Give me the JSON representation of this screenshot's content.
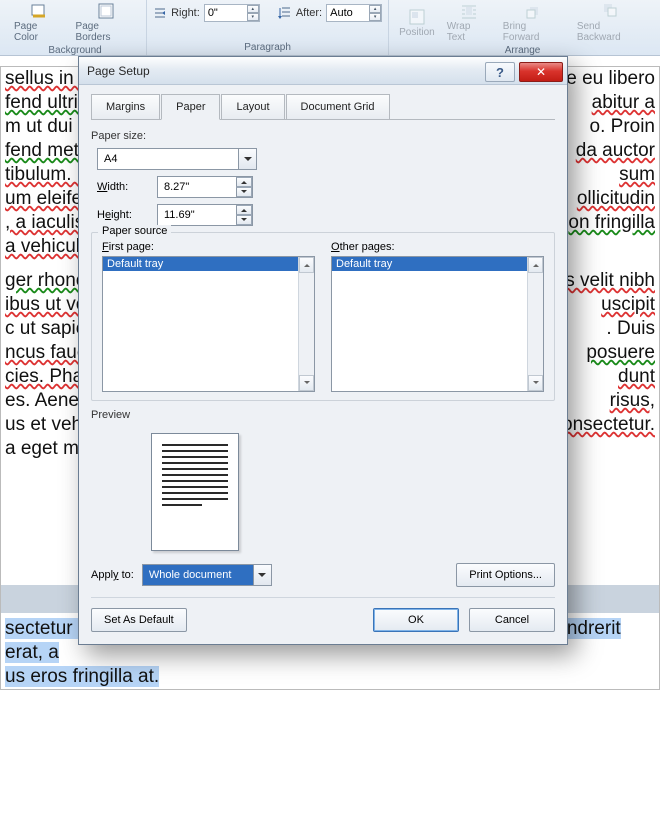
{
  "ribbon": {
    "page_group": {
      "color_label": "Page Color",
      "borders_label": "Page Borders",
      "group_label": "Background"
    },
    "para_group": {
      "right_label": "Right:",
      "right_val": "0\"",
      "after_label": "After:",
      "after_val": "Auto",
      "group_label": "Paragraph"
    },
    "arrange_group": {
      "position": "Position",
      "wrap": "Wrap Text",
      "bring": "Bring Forward",
      "send": "Send Backward",
      "group_label": "Arrange"
    }
  },
  "dialog": {
    "title": "Page Setup",
    "tabs": {
      "margins": "Margins",
      "paper": "Paper",
      "layout": "Layout",
      "grid": "Document Grid"
    },
    "paper_size_label": "Paper size:",
    "paper_size_value": "A4",
    "width_label": "Width:",
    "width_value": "8.27\"",
    "height_label": "Height:",
    "height_value": "11.69\"",
    "source_label": "Paper source",
    "first_page_label": "First page:",
    "first_page_item": "Default tray",
    "other_pages_label": "Other pages:",
    "other_pages_item": "Default tray",
    "preview_label": "Preview",
    "apply_to_label": "Apply to:",
    "apply_to_value": "Whole document",
    "print_options": "Print Options...",
    "set_default": "Set As Default",
    "ok": "OK",
    "cancel": "Cancel",
    "help_glyph": "?",
    "close_glyph": "✕"
  },
  "doc": {
    "l1": "sellus in u",
    "l1b": "e eu libero",
    "l2": "fend ultric",
    "l2b": "abitur a",
    "l3": "m ut dui t",
    "l3b": "o. Proin",
    "l4": "fend metu",
    "l4b": "da auctor",
    "l5": "tibulum. L",
    "l5b": "sum",
    "l6": "um eleifer",
    "l6b": "ollicitudin",
    "l7": ", a iaculis",
    "l7b": "on fringilla",
    "l8": "a vehicula",
    "l9": "ger rhonc",
    "l9b": "is velit nibh",
    "l10": "ibus ut vo",
    "l10b": "uscipit",
    "l11": "c ut sapie",
    "l11b": ". Duis",
    "l12": "ncus fauci",
    "l12b": "posuere",
    "l13": "cies. Phar",
    "l13b": "dunt",
    "l14": "es. Aenea",
    "l14b": "risus,",
    "l15": "us et vehi",
    "l15b": "onsectetur.",
    "l16": "a eget ma",
    "bottom": "sectetur adipiscing elit. Etiam eget tellus nunc. Proin vestibulum hendrerit erat, a",
    "bottom2": "us eros fringilla at."
  }
}
